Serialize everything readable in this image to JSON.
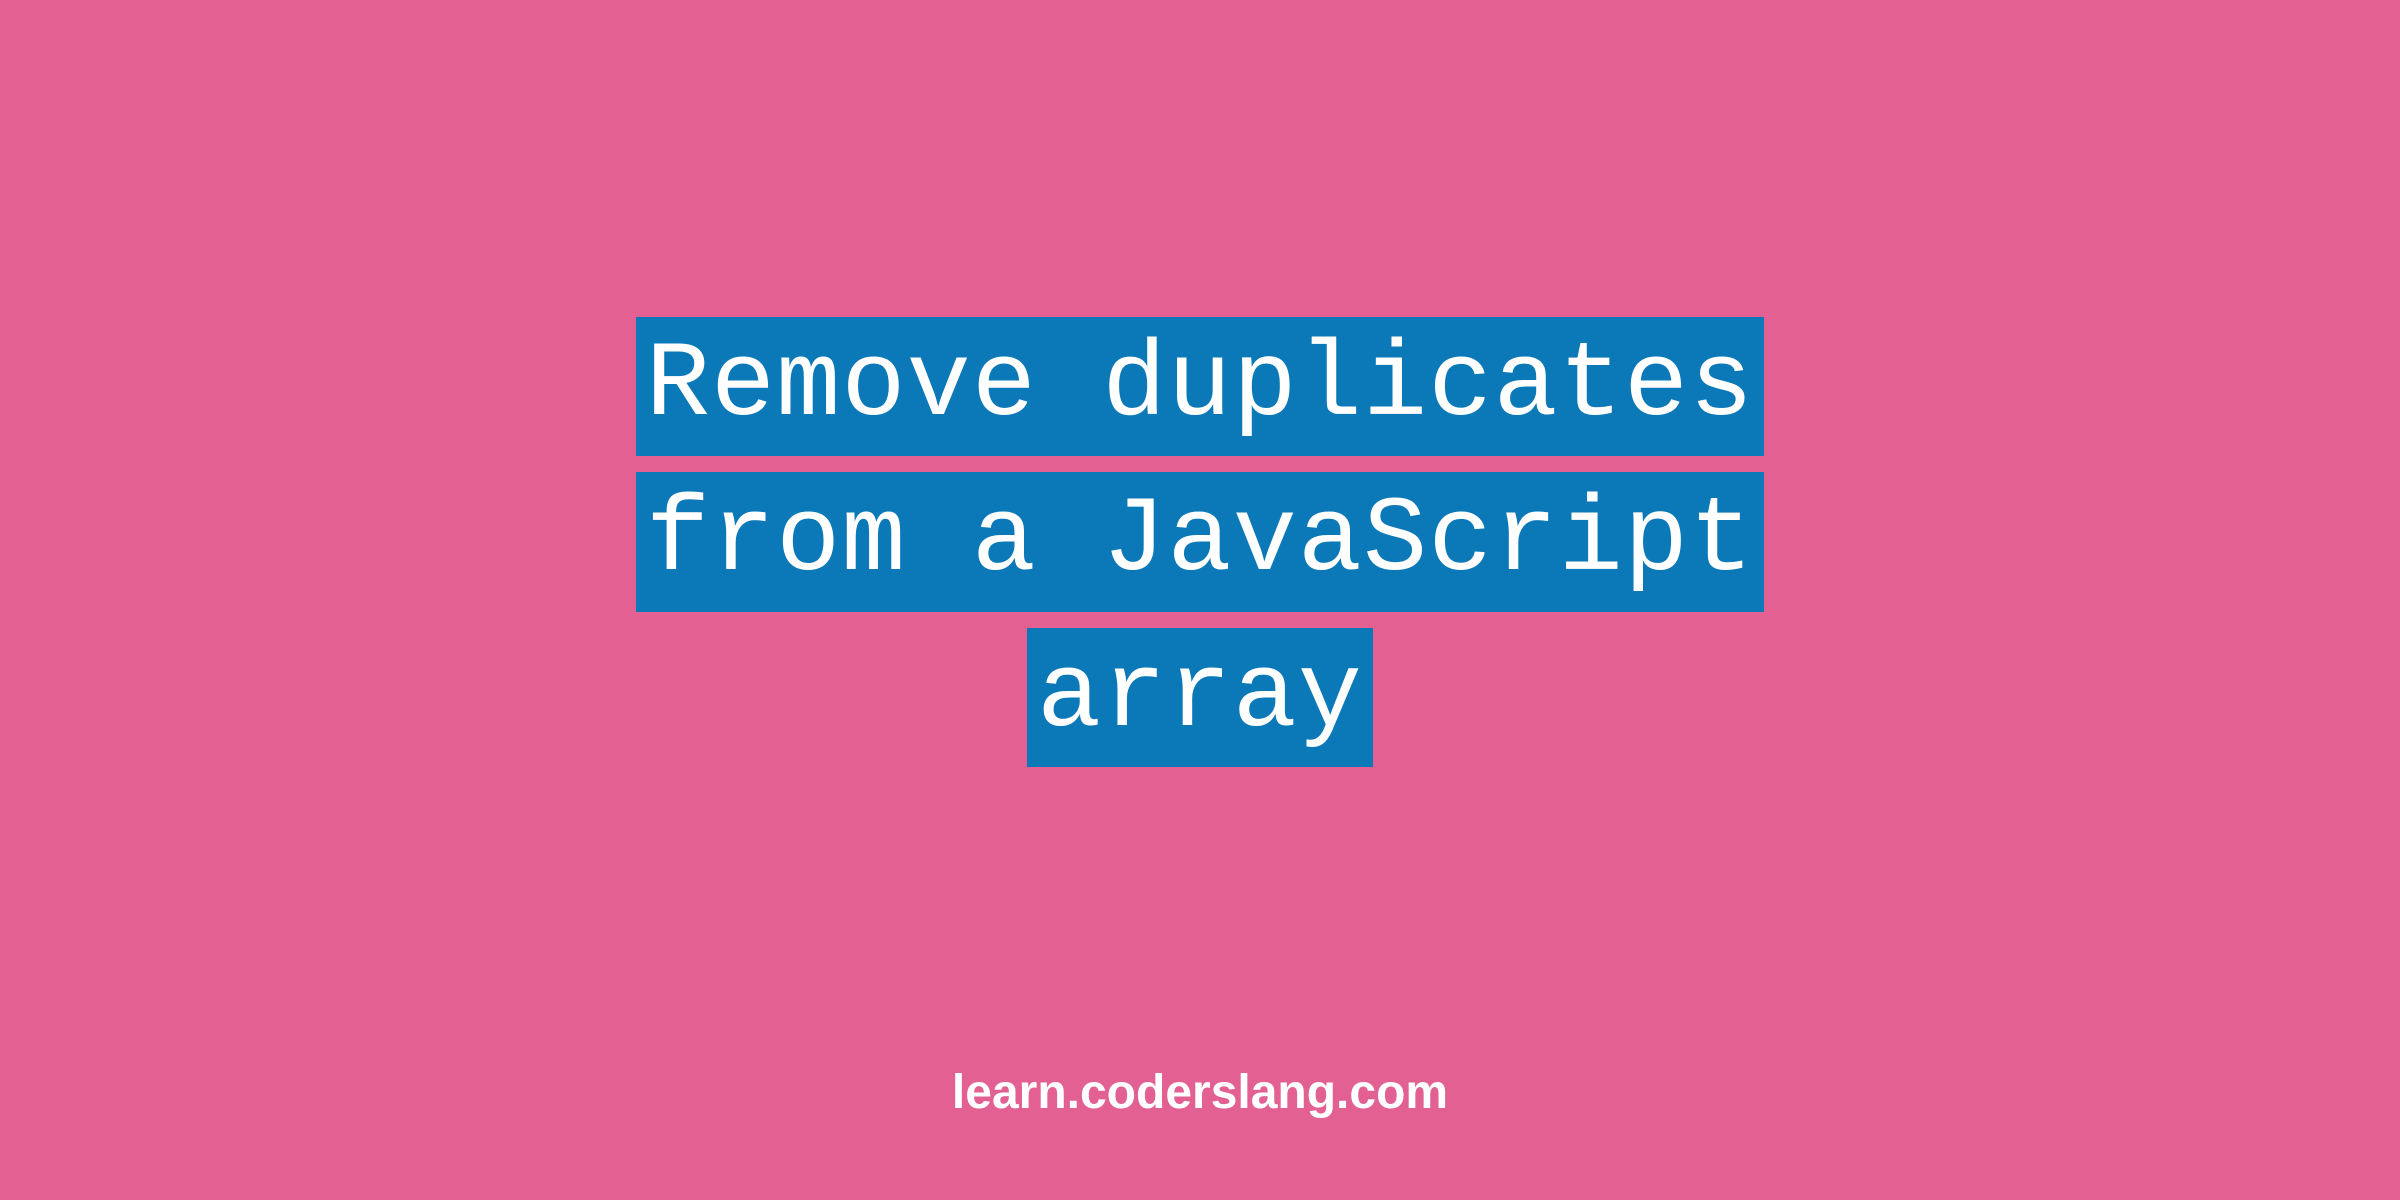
{
  "title": {
    "line1": "Remove duplicates",
    "line2": "from a JavaScript",
    "line3": "array"
  },
  "footer": {
    "text": "learn.coderslang.com"
  },
  "colors": {
    "background": "#e26092",
    "highlight": "#0b78b8",
    "text": "#ffffff"
  }
}
